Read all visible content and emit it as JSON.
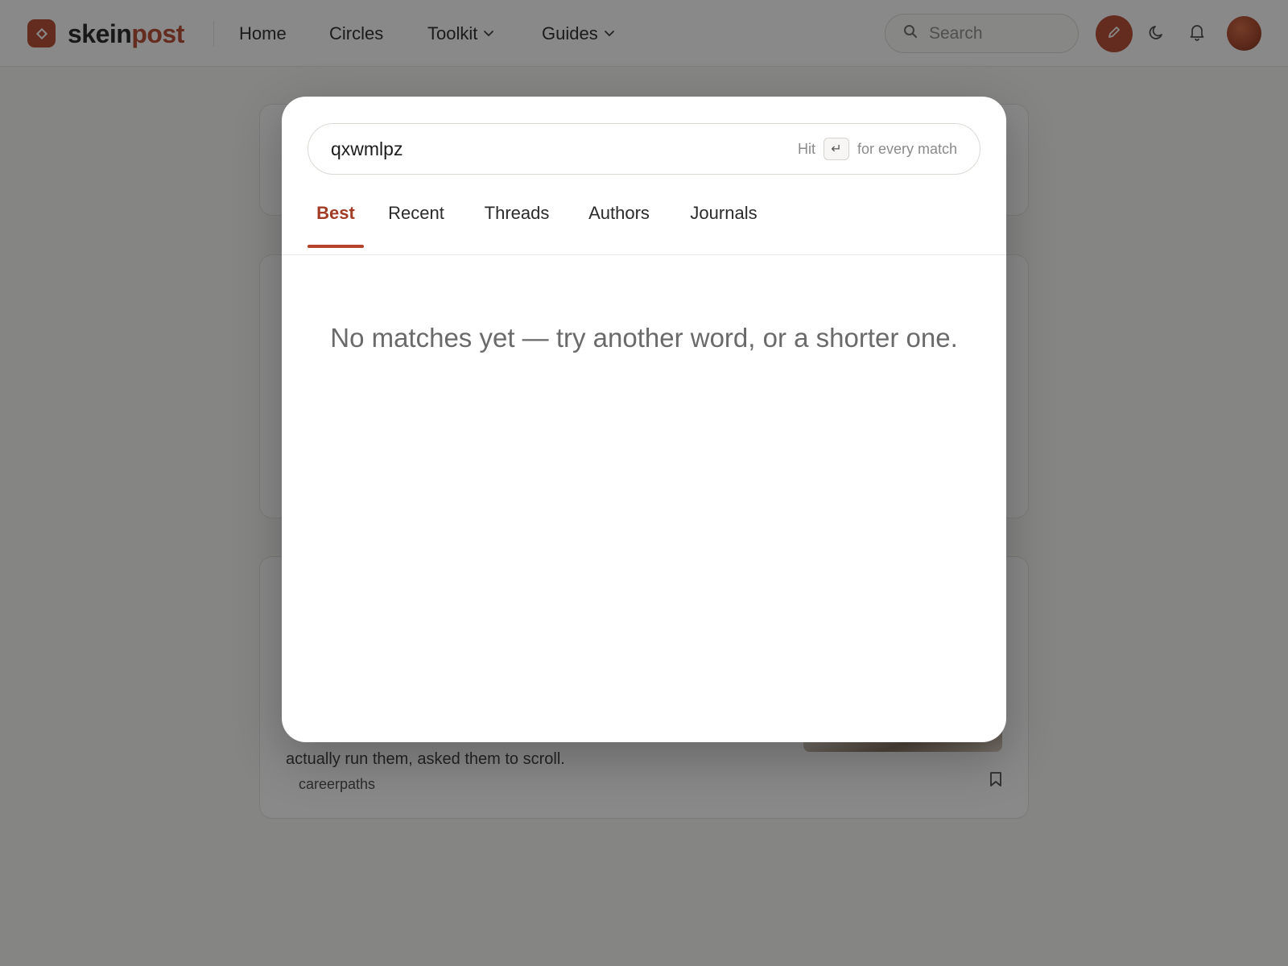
{
  "header": {
    "brand_part1": "skein",
    "brand_part2": "post",
    "nav": {
      "home": "Home",
      "circles": "Circles",
      "toolkit": "Toolkit",
      "guides": "Guides"
    },
    "search_placeholder": "Search"
  },
  "feed": {
    "card3_excerpt": "actually run them, asked them to scroll.",
    "card3_tag": "careerpaths"
  },
  "modal": {
    "query": "qxwmlpz",
    "hint_prefix": "Hit",
    "hint_key": "↵",
    "hint_suffix": "for every match",
    "tabs": {
      "best": "Best",
      "recent": "Recent",
      "threads": "Threads",
      "authors": "Authors",
      "journals": "Journals"
    },
    "active_tab": "Best",
    "empty_message": "No matches yet — try another word, or a shorter one."
  },
  "colors": {
    "accent": "#b5432b",
    "overlay": "rgba(20,20,20,0.5)"
  }
}
